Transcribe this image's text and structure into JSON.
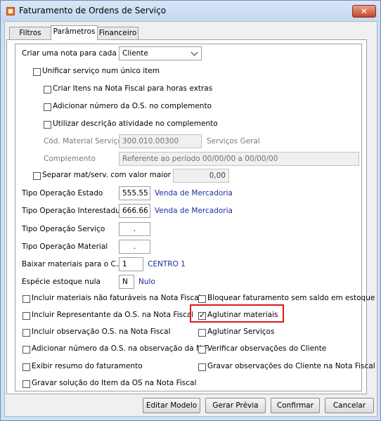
{
  "window": {
    "title": "Faturamento de Ordens de Serviço",
    "close_label": "✕"
  },
  "tabs": [
    {
      "label": "Filtros"
    },
    {
      "label": "Parâmetros"
    },
    {
      "label": "Financeiro"
    }
  ],
  "params": {
    "nota_por": {
      "label": "Criar uma nota para cada",
      "value": "Cliente"
    },
    "unificar": {
      "label": "Unificar serviço num único item",
      "checked": false
    },
    "itens_horas": {
      "label": "Criar Itens na Nota Fiscal para horas extras",
      "checked": false
    },
    "num_os_compl": {
      "label": "Adicionar número da O.S. no complemento",
      "checked": false
    },
    "desc_atividade": {
      "label": "Utilizar descrição atividade no complemento",
      "checked": false
    },
    "cod_material": {
      "label": "Cód. Material Serviço",
      "value": "300.010.00300",
      "desc": "Serviços Geral"
    },
    "complemento": {
      "label": "Complemento",
      "value": "Referente ao período 00/00/00 a 00/00/00"
    },
    "separar": {
      "label": "Separar mat/serv. com valor maior que",
      "value": "0,00",
      "checked": false
    },
    "op_estado": {
      "label": "Tipo Operação Estado",
      "value": "555.55",
      "desc": "Venda de Mercadoria"
    },
    "op_interestadual": {
      "label": "Tipo Operação Interestadual",
      "value": "666.66",
      "desc": "Venda de Mercadoria"
    },
    "op_servico": {
      "label": "Tipo Operação Serviço",
      "value": "."
    },
    "op_material": {
      "label": "Tipo Operação Material",
      "value": "."
    },
    "baixar_ca": {
      "label": "Baixar materiais para o C.A.",
      "value": "1",
      "desc": "CENTRO 1"
    },
    "especie_nula": {
      "label": "Espécie estoque nula",
      "value": "N",
      "desc": "Nulo"
    }
  },
  "checks": {
    "nao_faturaveis": {
      "label": "Incluir materiais não faturáveis na Nota Fiscal",
      "checked": false
    },
    "representante": {
      "label": "Incluir Representante da O.S. na Nota Fiscal",
      "checked": false
    },
    "obs_os": {
      "label": "Incluir observação O.S. na Nota Fiscal",
      "checked": false
    },
    "num_os_obs": {
      "label": "Adicionar número da O.S. na observação da N.F.",
      "checked": false
    },
    "resumo": {
      "label": "Exibir resumo do faturamento",
      "checked": false
    },
    "solucao_item": {
      "label": "Gravar solução do Item da OS na Nota Fiscal",
      "checked": false
    },
    "bloquear": {
      "label": "Bloquear faturamento sem saldo em estoque",
      "checked": false
    },
    "aglutinar_mat": {
      "label": "Aglutinar materiais",
      "checked": true
    },
    "aglutinar_serv": {
      "label": "Aglutinar Serviços",
      "checked": false
    },
    "verificar_obs": {
      "label": "Verificar observações do Cliente",
      "checked": false
    },
    "gravar_obs_cliente": {
      "label": "Gravar observações do Cliente na Nota Fiscal",
      "checked": false
    }
  },
  "buttons": {
    "editar_modelo": "Editar Modelo",
    "gerar_previa": "Gerar Prévia",
    "confirmar": "Confirmar",
    "cancelar": "Cancelar"
  }
}
